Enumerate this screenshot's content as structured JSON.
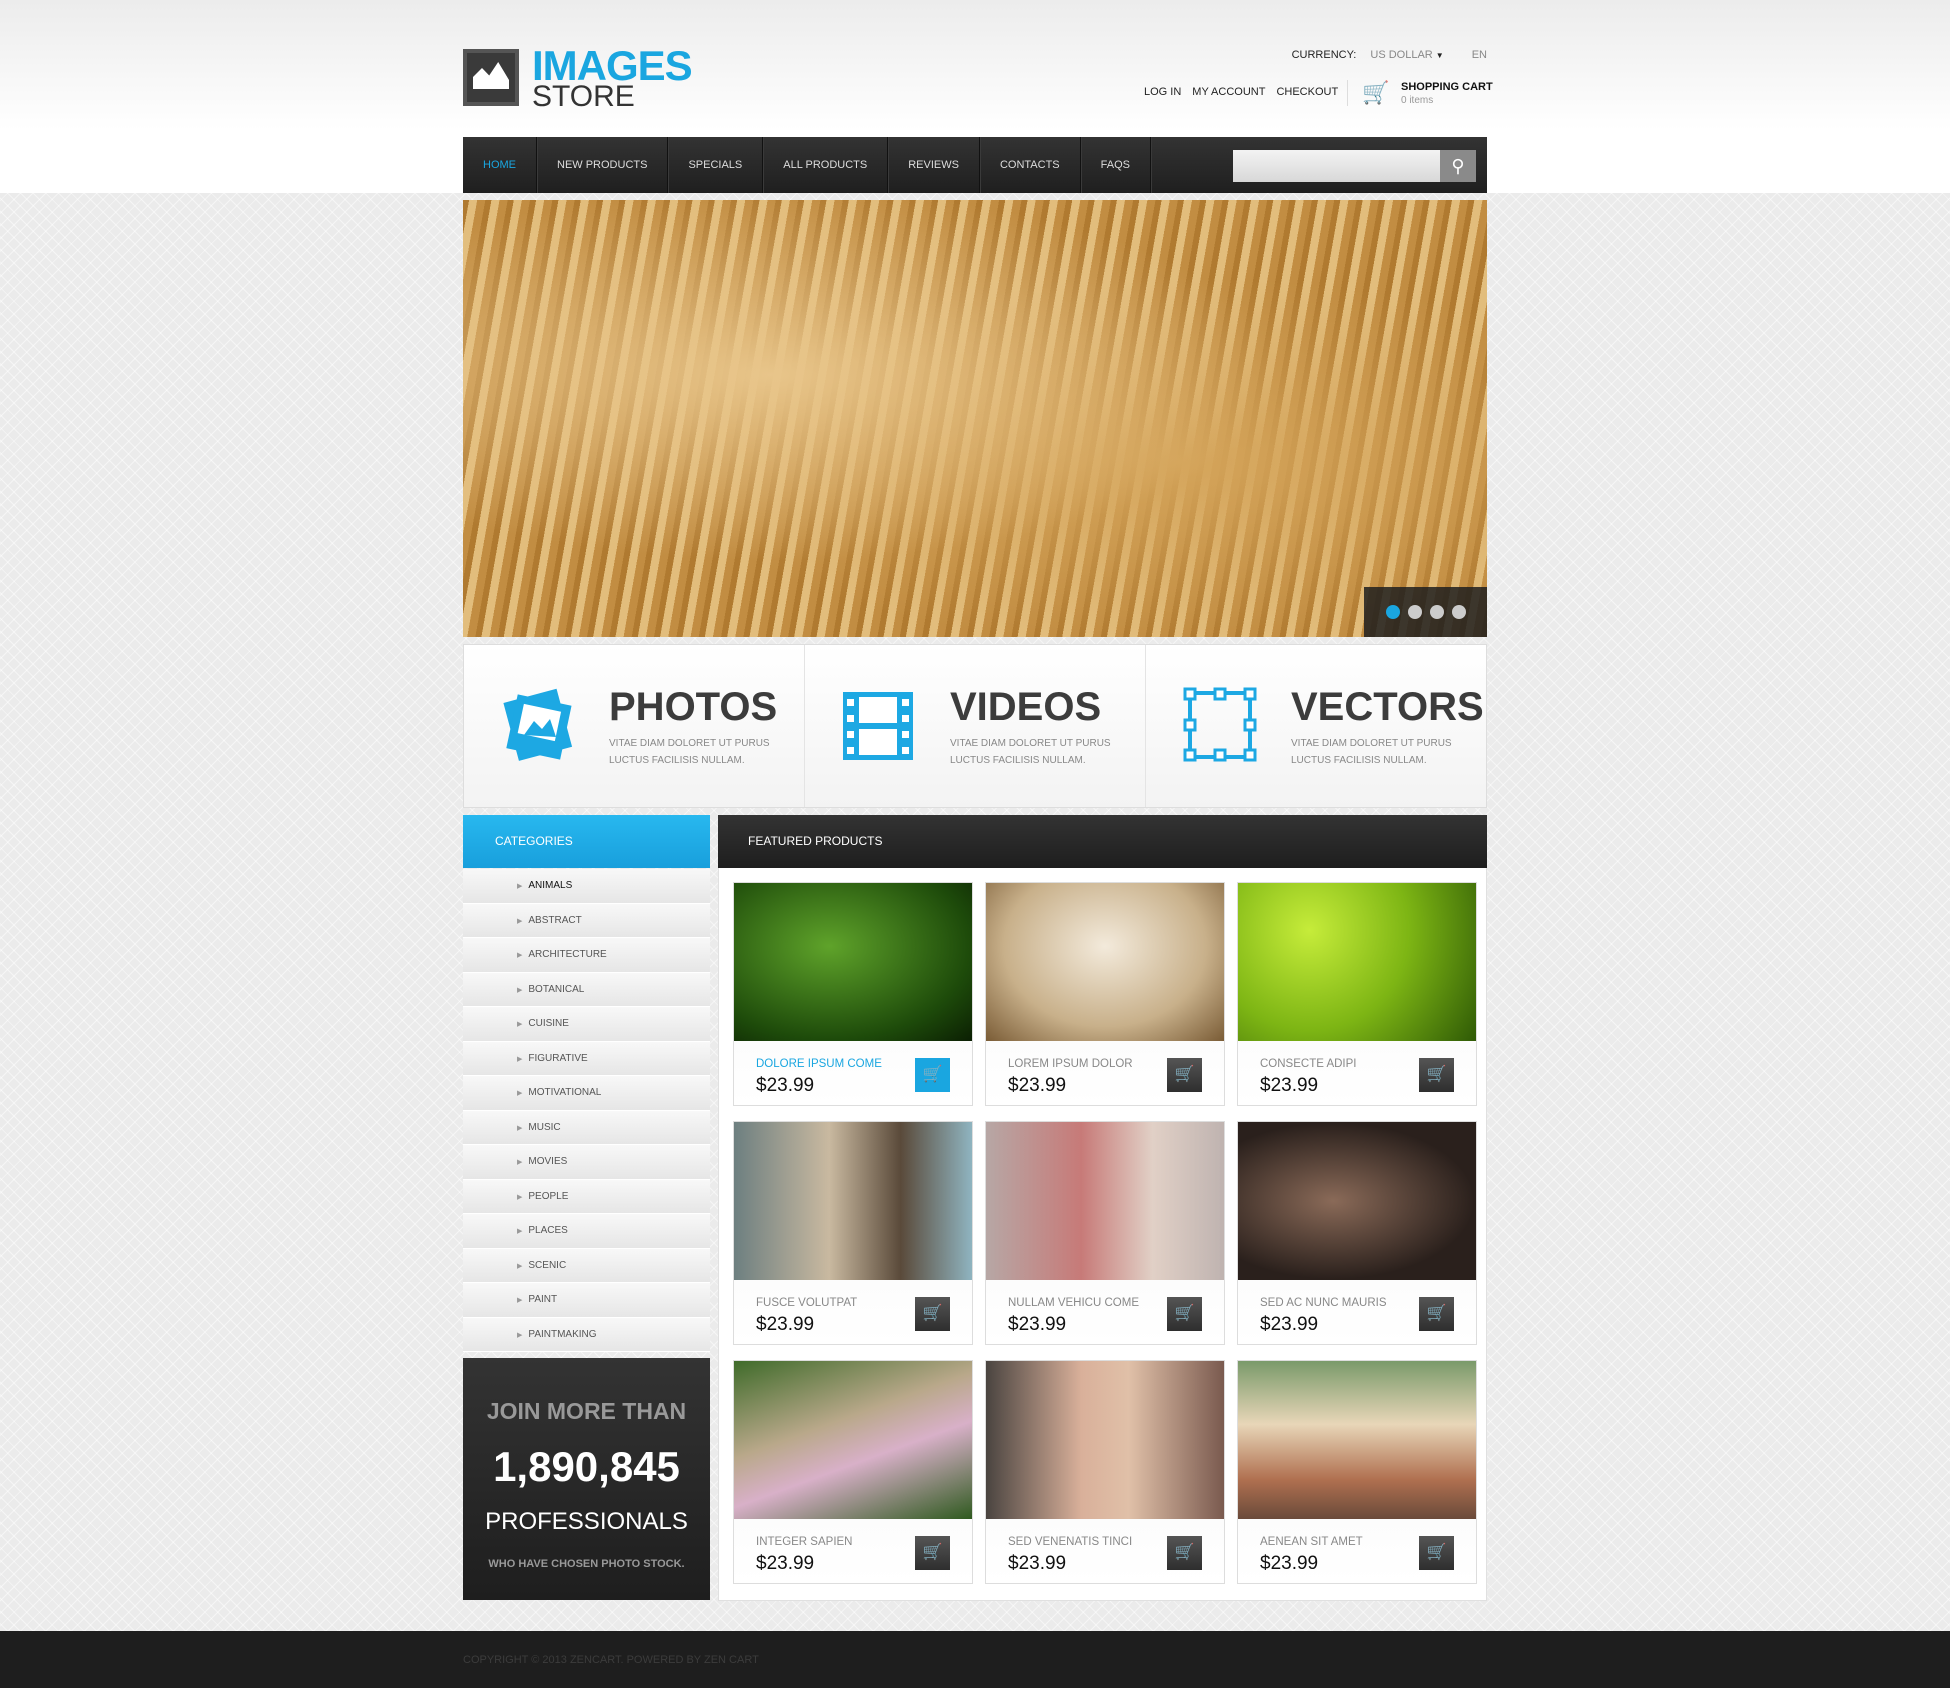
{
  "header": {
    "logo_line1": "IMAGES",
    "logo_line2": "STORE",
    "currency_label": "CURRENCY:",
    "currency_value": "US DOLLAR",
    "language": "EN",
    "links": [
      "LOG IN",
      "MY ACCOUNT",
      "CHECKOUT"
    ],
    "cart_title": "SHOPPING CART",
    "cart_items": "0 items"
  },
  "nav": {
    "items": [
      "HOME",
      "NEW PRODUCTS",
      "SPECIALS",
      "ALL PRODUCTS",
      "REVIEWS",
      "CONTACTS",
      "FAQS"
    ],
    "active": "HOME",
    "search_value": ""
  },
  "slider": {
    "slides": 4,
    "active_slide": 1
  },
  "features": [
    {
      "title": "PHOTOS",
      "desc": "VITAE DIAM DOLORET UT PURUS LUCTUS FACILISIS NULLAM.",
      "icon": "photos-icon"
    },
    {
      "title": "VIDEOS",
      "desc": "VITAE DIAM DOLORET UT PURUS LUCTUS FACILISIS NULLAM.",
      "icon": "film-icon"
    },
    {
      "title": "VECTORS",
      "desc": "VITAE DIAM DOLORET UT PURUS LUCTUS FACILISIS NULLAM.",
      "icon": "vector-icon"
    }
  ],
  "sidebar": {
    "title": "CATEGORIES",
    "categories": [
      "ANIMALS",
      "ABSTRACT",
      "ARCHITECTURE",
      "BOTANICAL",
      "CUISINE",
      "FIGURATIVE",
      "MOTIVATIONAL",
      "MUSIC",
      "MOVIES",
      "PEOPLE",
      "PLACES",
      "SCENIC",
      "PAINT",
      "PAINTMAKING"
    ]
  },
  "join": {
    "line1": "JOIN MORE THAN",
    "count": "1,890,845",
    "line3": "PROFESSIONALS",
    "line4": "WHO HAVE CHOSEN PHOTO STOCK."
  },
  "featured": {
    "title": "FEATURED PRODUCTS",
    "products": [
      {
        "name": "DOLORE IPSUM COME",
        "price": "$23.99"
      },
      {
        "name": "LOREM IPSUM DOLOR",
        "price": "$23.99"
      },
      {
        "name": "CONSECTE ADIPI",
        "price": "$23.99"
      },
      {
        "name": "FUSCE VOLUTPAT",
        "price": "$23.99"
      },
      {
        "name": "NULLAM VEHICU COME",
        "price": "$23.99"
      },
      {
        "name": "SED AC NUNC MAURIS",
        "price": "$23.99"
      },
      {
        "name": "INTEGER SAPIEN",
        "price": "$23.99"
      },
      {
        "name": "SED VENENATIS TINCI",
        "price": "$23.99"
      },
      {
        "name": "AENEAN SIT AMET",
        "price": "$23.99"
      }
    ]
  },
  "footer": {
    "copyright": "COPYRIGHT © 2013 ZENCART. POWERED BY ZEN CART"
  },
  "colors": {
    "accent": "#1aa6e0",
    "dark": "#1e1e1e"
  }
}
